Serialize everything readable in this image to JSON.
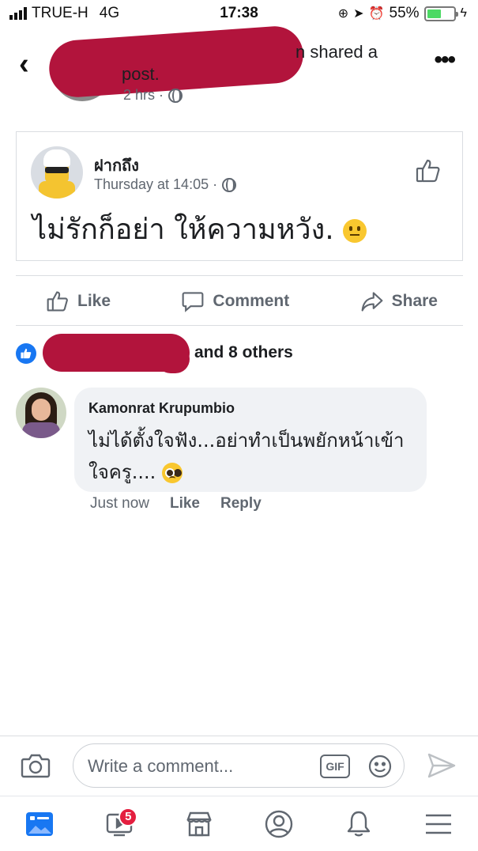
{
  "status_bar": {
    "carrier": "TRUE-H",
    "network": "4G",
    "time": "17:38",
    "battery": "55%",
    "battery_fraction": 0.55
  },
  "header": {
    "shared_text_line1": "n shared a",
    "shared_text_line2": "post.",
    "time": "2 hrs ·",
    "back_icon": "chevron-left-icon",
    "more_icon": "more-horizontal-icon"
  },
  "shared_post": {
    "author": "ฝากถึง",
    "time": "Thursday at 14:05 ·",
    "text": "ไม่รักก็อย่า ให้ความหวัง."
  },
  "actions": {
    "like": "Like",
    "comment": "Comment",
    "share": "Share"
  },
  "reactions": {
    "summary": "and 8 others"
  },
  "comment": {
    "author": "Kamonrat Krupumbio",
    "text_line1": "ไม่ได้ตั้งใจฟัง...อย่าทำเป็นพยักหน้าเข้า",
    "text_line2": "ใจครู....",
    "time": "Just now",
    "like": "Like",
    "reply": "Reply"
  },
  "composer": {
    "placeholder": "Write a comment...",
    "gif": "GIF"
  },
  "nav": {
    "video_badge": "5",
    "items": [
      "news-feed-icon",
      "watch-icon",
      "marketplace-icon",
      "profile-icon",
      "notifications-icon",
      "menu-icon"
    ]
  },
  "colors": {
    "accent": "#1877f2",
    "redaction": "#b2143c",
    "badge": "#e41e3f",
    "secondary_text": "#606770"
  }
}
